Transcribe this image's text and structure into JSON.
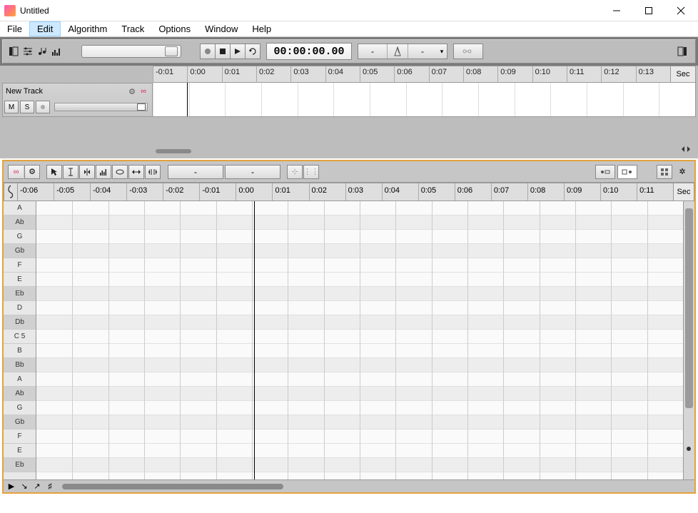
{
  "window": {
    "title": "Untitled"
  },
  "menu": {
    "items": [
      "File",
      "Edit",
      "Algorithm",
      "Track",
      "Options",
      "Window",
      "Help"
    ],
    "active_index": 1
  },
  "toolbar": {
    "time_display": "00:00:00.00",
    "tempo_left": "-",
    "tempo_right": "-"
  },
  "top_ruler": {
    "ticks": [
      "-0:01",
      "0:00",
      "0:01",
      "0:02",
      "0:03",
      "0:04",
      "0:05",
      "0:06",
      "0:07",
      "0:08",
      "0:09",
      "0:10",
      "0:11",
      "0:12",
      "0:13"
    ],
    "unit_label": "Sec"
  },
  "track": {
    "name": "New Track",
    "mute": "M",
    "solo": "S"
  },
  "editor": {
    "info_left": "-",
    "info_right": "-",
    "ruler": [
      "-0:06",
      "-0:05",
      "-0:04",
      "-0:03",
      "-0:02",
      "-0:01",
      "0:00",
      "0:01",
      "0:02",
      "0:03",
      "0:04",
      "0:05",
      "0:06",
      "0:07",
      "0:08",
      "0:09",
      "0:10",
      "0:11"
    ],
    "unit_label": "Sec",
    "keys": [
      "A",
      "Ab",
      "G",
      "Gb",
      "F",
      "E",
      "Eb",
      "D",
      "Db",
      "C 5",
      "B",
      "Bb",
      "A",
      "Ab",
      "G",
      "Gb",
      "F",
      "E",
      "Eb"
    ],
    "black_keys": [
      "Ab",
      "Gb",
      "Eb",
      "Db",
      "Bb"
    ]
  }
}
